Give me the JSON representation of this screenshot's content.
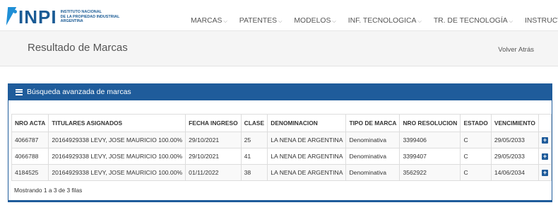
{
  "brand": {
    "logo_text": "INPI",
    "lines": [
      "INSTITUTO NACIONAL",
      "DE LA PROPIEDAD INDUSTRIAL",
      "ARGENTINA"
    ]
  },
  "nav": {
    "items": [
      {
        "label": "MARCAS"
      },
      {
        "label": "PATENTES"
      },
      {
        "label": "MODELOS"
      },
      {
        "label": "INF. TECNOLOGICA"
      },
      {
        "label": "TR. DE TECNOLOGÍA"
      },
      {
        "label": "INSTRUCTIVOS"
      }
    ]
  },
  "page": {
    "title": "Resultado de Marcas",
    "back_label": "Volver Atrás"
  },
  "panel": {
    "title": "Búsqueda avanzada de marcas"
  },
  "table": {
    "headers": [
      "NRO ACTA",
      "TITULARES ASIGNADOS",
      "FECHA INGRESO",
      "CLASE",
      "DENOMINACION",
      "TIPO DE MARCA",
      "NRO RESOLUCION",
      "ESTADO",
      "VENCIMIENTO",
      ""
    ],
    "rows": [
      [
        "4066787",
        "20164929338 LEVY, JOSE MAURICIO 100.00%",
        "29/10/2021",
        "25",
        "LA NENA DE ARGENTINA",
        "Denominativa",
        "3399406",
        "C",
        "29/05/2033"
      ],
      [
        "4066788",
        "20164929338 LEVY, JOSE MAURICIO 100.00%",
        "29/10/2021",
        "41",
        "LA NENA DE ARGENTINA",
        "Denominativa",
        "3399407",
        "C",
        "29/05/2033"
      ],
      [
        "4184525",
        "20164929338 LEVY, JOSE MAURICIO 100.00%",
        "01/11/2022",
        "38",
        "LA NENA DE ARGENTINA",
        "Denominativa",
        "3562922",
        "C",
        "14/06/2034"
      ]
    ],
    "footer": "Mostrando 1 a 3 de 3 filas"
  },
  "colors": {
    "brand_blue": "#1f5c9b",
    "logo_blue": "#1a5b95"
  },
  "icons": {
    "chevron": "chevron-down-icon",
    "panel": "list-icon",
    "row_action": "plus-square-icon"
  }
}
